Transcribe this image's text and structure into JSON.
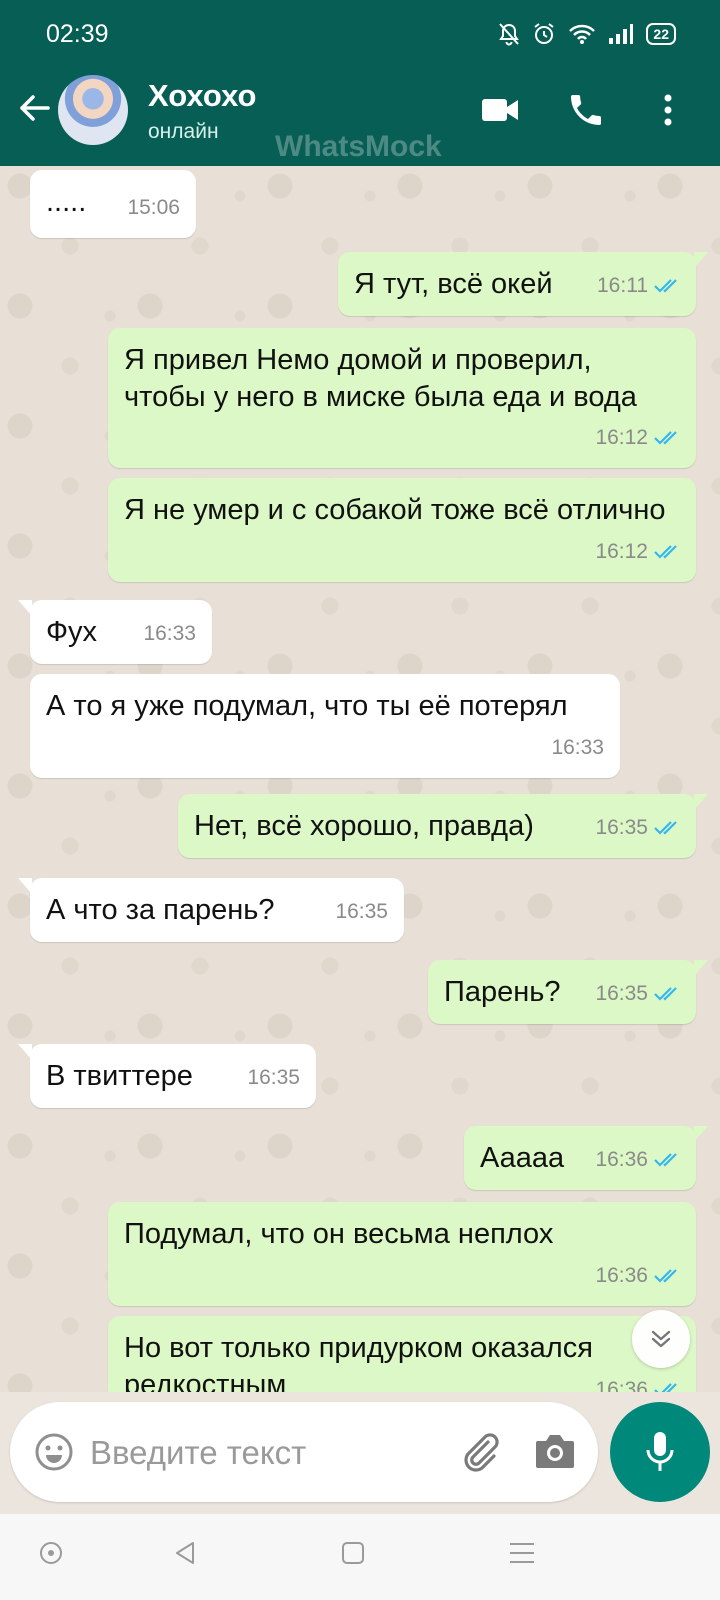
{
  "status_bar": {
    "time": "02:39",
    "battery": "22"
  },
  "header": {
    "contact_name": "Хохохо",
    "contact_status": "онлайн",
    "watermark": "WhatsMock"
  },
  "messages": [
    {
      "direction": "in",
      "text": ".....",
      "time": "15:06"
    },
    {
      "direction": "out",
      "text": "Я тут, всё окей",
      "time": "16:11",
      "read": true
    },
    {
      "direction": "out",
      "text": "Я привел Немо домой и проверил, чтобы у него в миске была еда и вода",
      "time": "16:12",
      "read": true
    },
    {
      "direction": "out",
      "text": "Я не умер и с собакой тоже всё отлично",
      "time": "16:12",
      "read": true
    },
    {
      "direction": "in",
      "text": "Фух",
      "time": "16:33"
    },
    {
      "direction": "in",
      "text": "А то я уже подумал, что ты её потерял",
      "time": "16:33"
    },
    {
      "direction": "out",
      "text": "Нет, всё хорошо, правда)",
      "time": "16:35",
      "read": true
    },
    {
      "direction": "in",
      "text": "А что за парень?",
      "time": "16:35"
    },
    {
      "direction": "out",
      "text": "Парень?",
      "time": "16:35",
      "read": true
    },
    {
      "direction": "in",
      "text": "В твиттере",
      "time": "16:35"
    },
    {
      "direction": "out",
      "text": "Ааааа",
      "time": "16:36",
      "read": true
    },
    {
      "direction": "out",
      "text": "Подумал, что он весьма неплох",
      "time": "16:36",
      "read": true
    },
    {
      "direction": "out",
      "text": "Но вот только придурком оказался редкостным",
      "time": "16:36",
      "read": true
    }
  ],
  "input": {
    "placeholder": "Введите текст"
  },
  "colors": {
    "header": "#075e54",
    "incoming_bubble": "#ffffff",
    "outgoing_bubble": "#dcf8c6",
    "read_ticks": "#34b7f1",
    "mic_button": "#00897b"
  },
  "icons": {
    "back": "arrow-left-icon",
    "video": "video-call-icon",
    "call": "phone-icon",
    "menu": "more-vertical-icon",
    "emoji": "emoji-icon",
    "attach": "paperclip-icon",
    "camera": "camera-icon",
    "mic": "microphone-icon",
    "scroll": "chevron-double-down-icon"
  }
}
